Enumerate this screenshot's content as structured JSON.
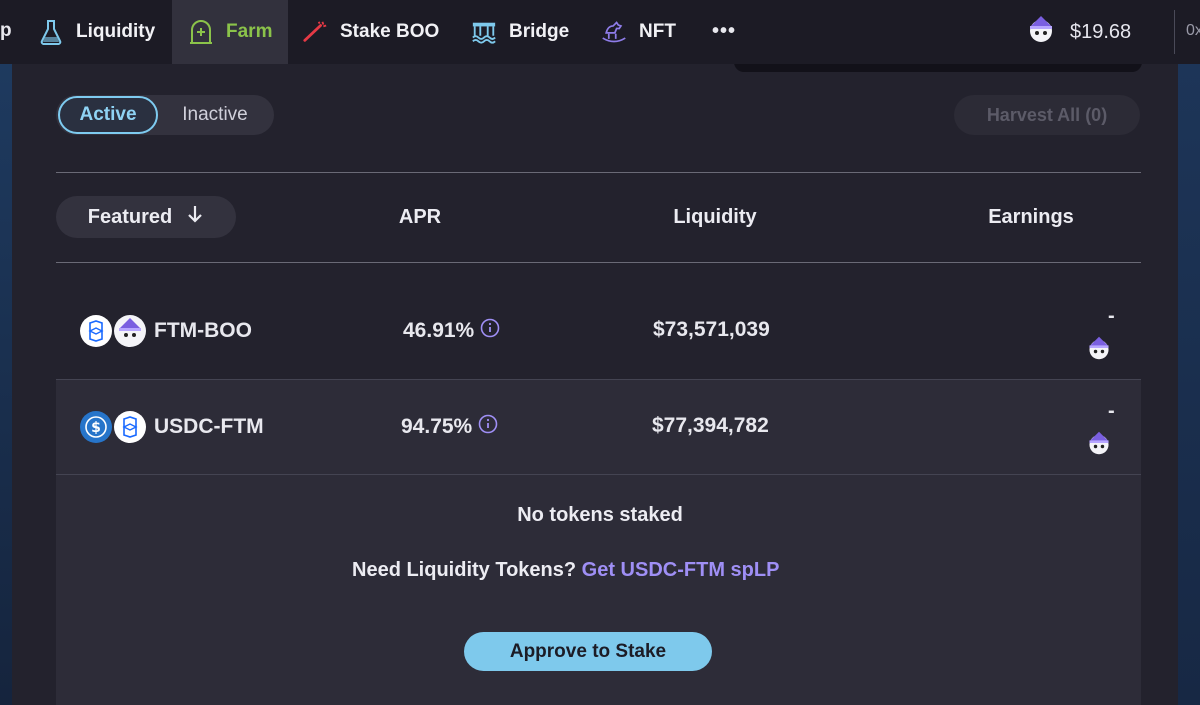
{
  "nav": {
    "cut_left": "p",
    "items": [
      {
        "label": "Liquidity"
      },
      {
        "label": "Farm"
      },
      {
        "label": "Stake BOO"
      },
      {
        "label": "Bridge"
      },
      {
        "label": "NFT"
      }
    ],
    "more": "•••",
    "balance": "$19.68",
    "address_cut": "0x"
  },
  "filters": {
    "active": "Active",
    "inactive": "Inactive",
    "harvest_all": "Harvest All (0)"
  },
  "table": {
    "headers": {
      "featured": "Featured",
      "apr": "APR",
      "liquidity": "Liquidity",
      "earnings": "Earnings"
    },
    "rows": [
      {
        "pair": "FTM-BOO",
        "apr": "46.91%",
        "liquidity": "$73,571,039",
        "earnings": "-"
      },
      {
        "pair": "USDC-FTM",
        "apr": "94.75%",
        "liquidity": "$77,394,782",
        "earnings": "-"
      }
    ]
  },
  "expanded": {
    "no_tokens": "No tokens staked",
    "need_prefix": "Need Liquidity Tokens?",
    "need_link": "Get USDC-FTM spLP",
    "approve": "Approve to Stake"
  },
  "colors": {
    "accent_blue": "#7ec9ec",
    "farm_green": "#8bc34a",
    "link_purple": "#9f8ff5"
  }
}
